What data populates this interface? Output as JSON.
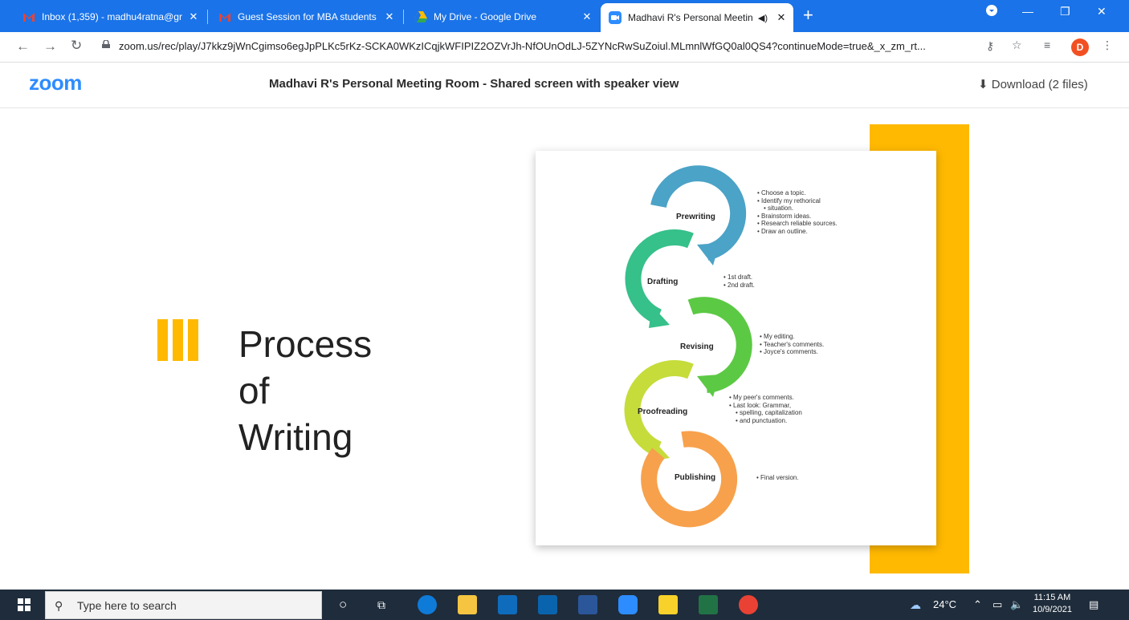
{
  "browser": {
    "tabs": [
      {
        "title": "Inbox (1,359) - madhu4ratna@gr",
        "icon": "gmail-icon",
        "close": "✕"
      },
      {
        "title": "Guest Session for MBA students",
        "icon": "gmail-icon",
        "close": "✕"
      },
      {
        "title": "My Drive - Google Drive",
        "icon": "google-drive-icon",
        "close": "✕"
      },
      {
        "title": "Madhavi R's Personal Meetin",
        "icon": "zoom-icon",
        "close": "✕"
      }
    ],
    "new_tab": "+",
    "url": "zoom.us/rec/play/J7kkz9jWnCgimso6egJpPLKc5rKz-SCKA0WKzICqjkWFIPIZ2OZVrJh-NfOUnOdLJ-5ZYNcRwSuZoiul.MLmnlWfGQ0al0QS4?continueMode=true&_x_zm_rt...",
    "profile_initial": "D",
    "accent": "#1a73e8"
  },
  "zoom": {
    "logo": "zoom",
    "title": "Madhavi R's Personal Meeting Room - Shared screen with speaker view",
    "download": "Download (2 files)"
  },
  "slide": {
    "title_lines": [
      "Process",
      "of",
      "Writing"
    ],
    "steps": [
      {
        "name": "Prewriting",
        "color": "#4ba3c7",
        "notes": [
          "Choose a topic.",
          "Identify my rethorical",
          "situation.",
          "Brainstorm ideas.",
          "Research reliable sources.",
          "Draw an outline."
        ]
      },
      {
        "name": "Drafting",
        "color": "#36c08a",
        "notes": [
          "1st draft.",
          "2nd draft."
        ]
      },
      {
        "name": "Revising",
        "color": "#5cc944",
        "notes": [
          "My editing.",
          "Teacher's comments.",
          "Joyce's comments."
        ]
      },
      {
        "name": "Proofreading",
        "color": "#c6dc3a",
        "notes": [
          "My peer's comments.",
          "Last look: Grammar,",
          "spelling, capitalization",
          "and punctuation."
        ]
      },
      {
        "name": "Publishing",
        "color": "#f7a14c",
        "notes": [
          "Final version."
        ]
      }
    ]
  },
  "taskbar": {
    "search_placeholder": "Type here to search",
    "weather": "24°C",
    "time": "11:15 AM",
    "date": "10/9/2021"
  }
}
